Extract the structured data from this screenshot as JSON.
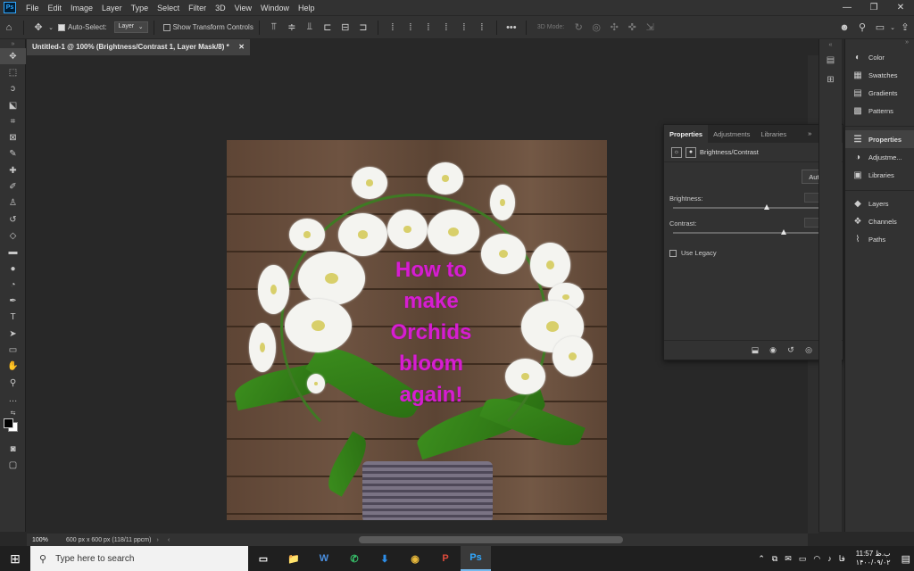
{
  "app": {
    "logo": "Ps",
    "menu": [
      "File",
      "Edit",
      "Image",
      "Layer",
      "Type",
      "Select",
      "Filter",
      "3D",
      "View",
      "Window",
      "Help"
    ],
    "window_controls": [
      "—",
      "❐",
      "✕"
    ]
  },
  "options_bar": {
    "auto_select_label": "Auto-Select:",
    "auto_select_target": "Layer",
    "show_transform_label": "Show Transform Controls",
    "mode_3d_label": "3D Mode:",
    "more_label": "•••"
  },
  "document": {
    "tab_title": "Untitled-1 @ 100% (Brightness/Contrast 1, Layer Mask/8) *",
    "close_symbol": "✕",
    "zoom": "100%",
    "info": "600 px x 600 px (118/11 ppcm)",
    "overlay_text_lines": [
      "How to",
      "make",
      "Orchids",
      "bloom",
      "again!"
    ],
    "overlay_color": "#d61ed0"
  },
  "properties": {
    "tabs": [
      "Properties",
      "Adjustments",
      "Libraries"
    ],
    "active_tab": "Properties",
    "layer_type": "Brightness/Contrast",
    "auto_label": "Auto",
    "brightness_label": "Brightness:",
    "brightness_value": "34",
    "brightness_fraction": 0.61,
    "contrast_label": "Contrast:",
    "contrast_value": "47",
    "contrast_fraction": 0.72,
    "use_legacy_label": "Use Legacy"
  },
  "dock": {
    "items": [
      {
        "icon": "color-icon",
        "glyph": "◐",
        "label": "Color"
      },
      {
        "icon": "swatches-icon",
        "glyph": "▦",
        "label": "Swatches"
      },
      {
        "icon": "gradients-icon",
        "glyph": "▤",
        "label": "Gradients"
      },
      {
        "icon": "patterns-icon",
        "glyph": "▩",
        "label": "Patterns"
      },
      {
        "icon": "properties-icon",
        "glyph": "☰",
        "label": "Properties"
      },
      {
        "icon": "adjustments-icon",
        "glyph": "◑",
        "label": "Adjustme..."
      },
      {
        "icon": "libraries-icon",
        "glyph": "▣",
        "label": "Libraries"
      },
      {
        "icon": "layers-icon",
        "glyph": "◆",
        "label": "Layers"
      },
      {
        "icon": "channels-icon",
        "glyph": "❖",
        "label": "Channels"
      },
      {
        "icon": "paths-icon",
        "glyph": "⌇",
        "label": "Paths"
      }
    ]
  },
  "taskbar": {
    "search_placeholder": "Type here to search",
    "apps": [
      "▭",
      "📁",
      "W",
      "✆",
      "⬇",
      "◉",
      "P",
      "Ps"
    ],
    "lang": "فا",
    "time": "11:57 ب.ظ",
    "date": "۱۴۰۰/۰۹/۰۲"
  }
}
